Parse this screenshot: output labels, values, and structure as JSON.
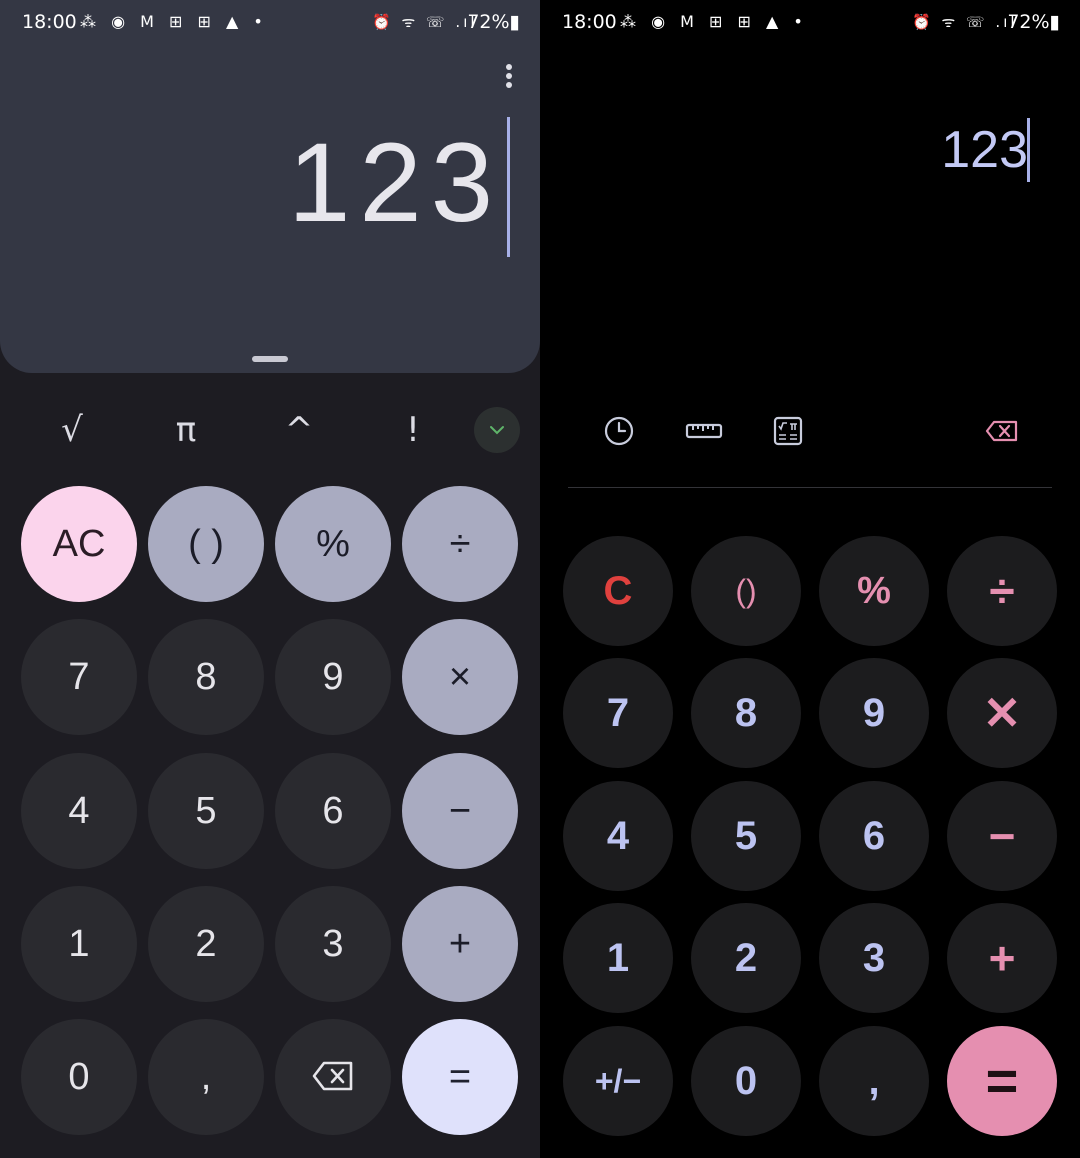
{
  "status_bar": {
    "time": "18:00",
    "notifications": "⁂ ◉ M ⊞ ⊞ ▲ •",
    "system": "⏰ ᯤ ☏ .ıl",
    "battery": "72%▮"
  },
  "left": {
    "display_value": "123",
    "scientific": [
      "√",
      "π",
      "^",
      "!"
    ],
    "keys": {
      "ac": "AC",
      "paren": "( )",
      "percent": "%",
      "divide": "÷",
      "seven": "7",
      "eight": "8",
      "nine": "9",
      "multiply": "×",
      "four": "4",
      "five": "5",
      "six": "6",
      "minus": "−",
      "one": "1",
      "two": "2",
      "three": "3",
      "plus": "+",
      "zero": "0",
      "comma": ",",
      "equals": "="
    },
    "icons": [
      "more-vert-icon",
      "chevron-down-icon",
      "backspace-icon"
    ]
  },
  "right": {
    "display_value": "123",
    "keys": {
      "clear": "C",
      "paren": "()",
      "percent": "%",
      "divide": "÷",
      "seven": "7",
      "eight": "8",
      "nine": "9",
      "multiply": "✕",
      "four": "4",
      "five": "5",
      "six": "6",
      "minus": "−",
      "one": "1",
      "two": "2",
      "three": "3",
      "plus": "+",
      "plus_minus": "+/−",
      "zero": "0",
      "comma": ",",
      "equals": "="
    },
    "icons": [
      "history-icon",
      "ruler-icon",
      "scientific-icon",
      "backspace-icon"
    ]
  },
  "colors": {
    "left_background": "#1d1c22",
    "left_display_card": "#343744",
    "left_operator_key": "#a9abc1",
    "left_ac_key": "#fbd4ec",
    "left_equals_key": "#dfe1fb",
    "right_background": "#000000",
    "right_digit_text": "#bcc3f1",
    "right_operator_accent": "#e58fb0",
    "right_clear_text": "#e0413e"
  }
}
